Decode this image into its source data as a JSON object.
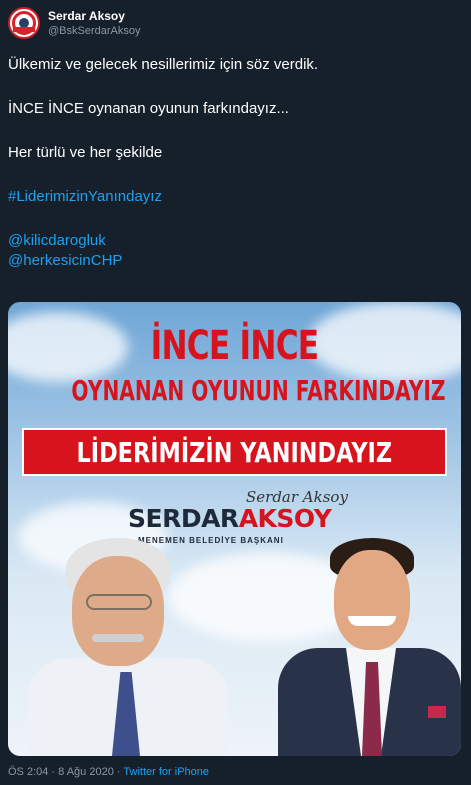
{
  "author": {
    "display_name": "Serdar Aksoy",
    "handle": "@BskSerdarAksoy",
    "avatar_icon": "party-logo-icon"
  },
  "tweet": {
    "lines": [
      "Ülkemiz ve gelecek nesillerimiz için söz verdik.",
      "İNCE İNCE oynanan oyunun farkındayız...",
      "Her türlü ve her şekilde"
    ],
    "hashtag": "#LiderimizinYanındayız",
    "mentions": [
      "@kilicdarogluk",
      "@herkesicinCHP"
    ]
  },
  "media": {
    "headline_1": "İNCE İNCE",
    "headline_2": "OYNANAN OYUNUN FARKINDAYIZ",
    "banner": "LİDERİMİZİN YANINDAYIZ",
    "signature": "Serdar Aksoy",
    "name_first": "SERDAR",
    "name_last": "AKSOY",
    "subtitle": "MENEMEN BELEDİYE BAŞKANI"
  },
  "footer": {
    "time": "ÖS 2:04",
    "separator": "·",
    "date": "8 Ağu 2020",
    "source": "Twitter for iPhone"
  },
  "colors": {
    "background": "#15202b",
    "link": "#1da1f2",
    "muted": "#8899a6",
    "brand_red": "#d7141e"
  }
}
